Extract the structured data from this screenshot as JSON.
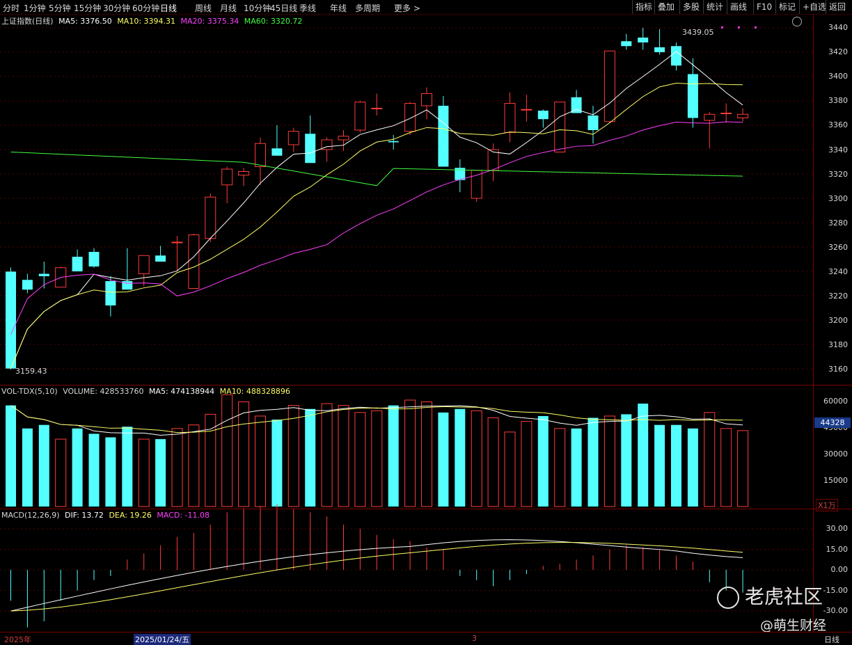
{
  "toolbar": {
    "periods": [
      "分时",
      "1分钟",
      "5分钟",
      "15分钟",
      "30分钟",
      "60分钟",
      "日线",
      "周线",
      "月线",
      "10分钟",
      "45日线",
      "季线",
      "年线",
      "多周期",
      "更多 >"
    ],
    "active_period": "日线",
    "tools": [
      "指标",
      "叠加",
      "多股",
      "统计",
      "画线",
      "F10",
      "标记",
      "+自选",
      "返回"
    ]
  },
  "main_legend": {
    "name": "上证指数(日线)",
    "ma5": "MA5: 3376.50",
    "ma10": "MA10: 3394.31",
    "ma20": "MA20: 3375.34",
    "ma60": "MA60: 3320.72"
  },
  "price_axis": [
    "3440",
    "3420",
    "3400",
    "3380",
    "3360",
    "3340",
    "3320",
    "3300",
    "3280",
    "3260",
    "3240",
    "3220",
    "3200",
    "3180",
    "3160"
  ],
  "high_label": "3439.05",
  "low_label": "3159.43",
  "vol_legend": {
    "name": "VOL-TDX(5,10)",
    "volume": "VOLUME: 428533760",
    "ma5": "MA5: 474138944",
    "ma10": "MA10: 488328896"
  },
  "vol_axis": [
    "60000",
    "45000",
    "30000",
    "15000"
  ],
  "vol_current": "44328",
  "vol_unit": "X1万",
  "macd_legend": {
    "name": "MACD(12,26,9)",
    "dif": "DIF: 13.72",
    "dea": "DEA: 19.26",
    "macd": "MACD: -11.08"
  },
  "macd_axis": [
    "30.00",
    "15.00",
    "0.00",
    "-15.00",
    "-30.00"
  ],
  "dates": {
    "start": "2025年",
    "active": "2025/01/24/五",
    "month": "3"
  },
  "bottom_right": "日线",
  "watermark": {
    "brand": "老虎社区",
    "author": "@萌生财经"
  },
  "colors": {
    "up": "#ff3b3b",
    "down": "#54ffff",
    "ma5": "#ffffff",
    "ma10": "#ffff66",
    "ma20": "#ff40ff",
    "ma60": "#40ff40"
  },
  "chart_data": {
    "type": "candlestick",
    "ohlc": [
      [
        3239.8,
        3243.2,
        3159.4,
        3160.2
      ],
      [
        3233,
        3238,
        3222,
        3225
      ],
      [
        3238,
        3248,
        3226,
        3236
      ],
      [
        3227,
        3244,
        3227,
        3243
      ],
      [
        3252,
        3258,
        3240,
        3240
      ],
      [
        3256,
        3259,
        3243,
        3244
      ],
      [
        3232,
        3236,
        3203,
        3212
      ],
      [
        3232,
        3259,
        3226,
        3225
      ],
      [
        3238,
        3253,
        3228,
        3253
      ],
      [
        3253,
        3261,
        3248,
        3248
      ],
      [
        3264,
        3269,
        3240,
        3264
      ],
      [
        3226,
        3271,
        3226,
        3270
      ],
      [
        3267,
        3304,
        3264,
        3301
      ],
      [
        3311,
        3326,
        3296,
        3324
      ],
      [
        3319,
        3325,
        3310,
        3322
      ],
      [
        3326,
        3350,
        3311,
        3345
      ],
      [
        3341,
        3360,
        3335,
        3335
      ],
      [
        3344,
        3358,
        3338,
        3355
      ],
      [
        3353,
        3368,
        3335,
        3329
      ],
      [
        3340,
        3350,
        3330,
        3348
      ],
      [
        3348,
        3356,
        3339,
        3351
      ],
      [
        3356,
        3380,
        3354,
        3379
      ],
      [
        3374,
        3386,
        3368,
        3374
      ],
      [
        3347,
        3352,
        3340,
        3346
      ],
      [
        3355,
        3379,
        3352,
        3378
      ],
      [
        3376,
        3391,
        3365,
        3386
      ],
      [
        3376,
        3384,
        3326,
        3326
      ],
      [
        3325,
        3332,
        3305,
        3315
      ],
      [
        3300,
        3320,
        3297,
        3323
      ],
      [
        3323,
        3345,
        3314,
        3340
      ],
      [
        3354,
        3387,
        3346,
        3378
      ],
      [
        3373,
        3385,
        3363,
        3373
      ],
      [
        3372,
        3373,
        3358,
        3365
      ],
      [
        3338,
        3375,
        3338,
        3379
      ],
      [
        3383,
        3389,
        3370,
        3370
      ],
      [
        3368,
        3376,
        3345,
        3356
      ],
      [
        3363,
        3421,
        3362,
        3421
      ],
      [
        3429,
        3435,
        3422,
        3425
      ],
      [
        3432,
        3440,
        3422,
        3428
      ],
      [
        3424,
        3439,
        3418,
        3420
      ],
      [
        3425,
        3428,
        3405,
        3409
      ],
      [
        3402,
        3415,
        3358,
        3366
      ],
      [
        3364,
        3371,
        3341,
        3369
      ],
      [
        3370,
        3378,
        3362,
        3370
      ],
      [
        3366,
        3374,
        3363,
        3369
      ]
    ],
    "volume": [
      57000,
      44000,
      46000,
      38000,
      44000,
      41000,
      39000,
      45000,
      38000,
      38000,
      44000,
      46000,
      52000,
      63000,
      59000,
      51000,
      49000,
      57000,
      55000,
      58000,
      57000,
      53000,
      54000,
      57000,
      60000,
      59000,
      53000,
      55000,
      54000,
      50000,
      42000,
      48000,
      51000,
      44000,
      44000,
      50000,
      51000,
      52000,
      58000,
      46000,
      46000,
      44000,
      53000,
      44000,
      42800
    ],
    "macd_hist": [
      -15,
      -28,
      -25,
      -15,
      -10,
      -5,
      -3,
      5,
      8,
      12,
      16,
      18,
      22,
      28,
      30,
      31,
      32,
      30,
      28,
      26,
      22,
      20,
      17,
      15,
      14,
      11,
      10,
      -3,
      -5,
      -8,
      -5,
      -2,
      2,
      3,
      5,
      7,
      10,
      12,
      11,
      10,
      7,
      4,
      -6,
      -10,
      -11.08
    ],
    "x_labels": [
      "2025年",
      "2025/01/24/五",
      "3"
    ]
  }
}
